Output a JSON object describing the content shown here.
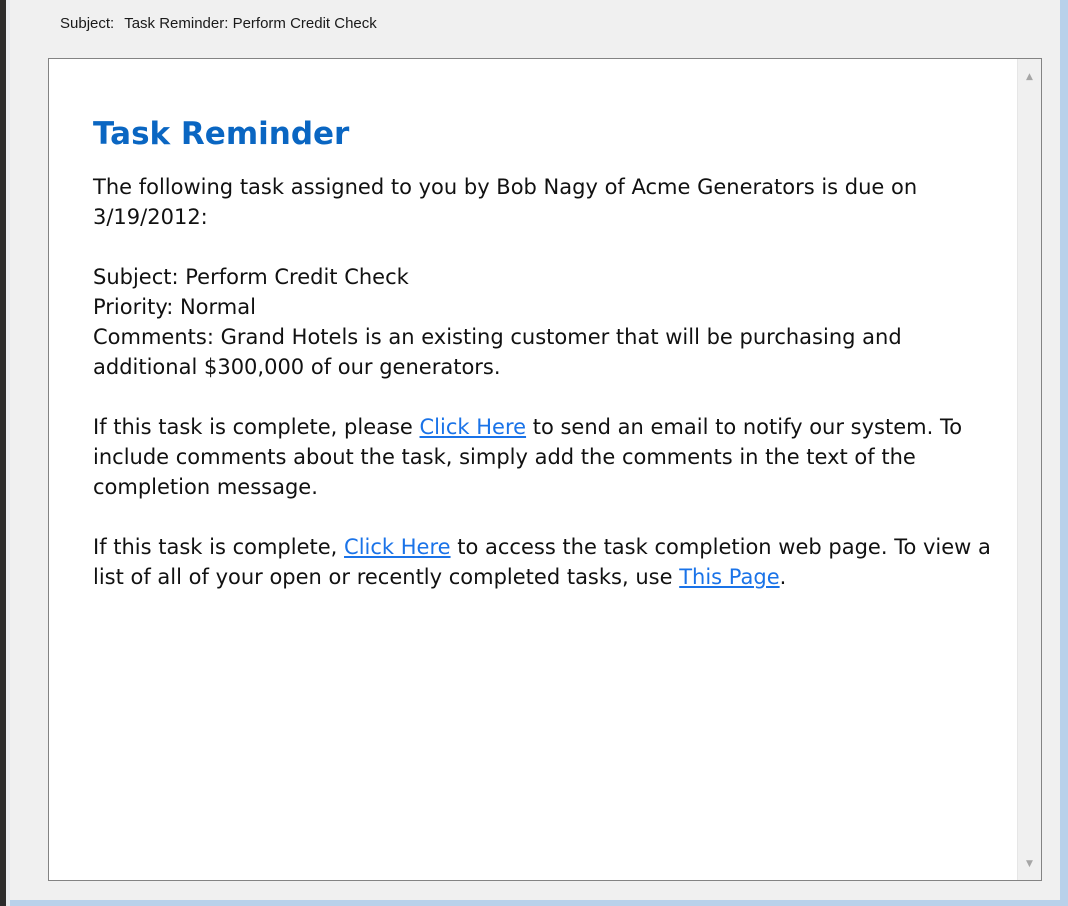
{
  "header": {
    "subject_label": "Subject:",
    "subject_value": "Task Reminder: Perform Credit Check"
  },
  "message": {
    "heading": "Task Reminder",
    "intro": "The following task assigned to you by Bob Nagy of Acme Generators is due on 3/19/2012:",
    "subject_line": "Subject: Perform Credit Check",
    "priority_line": "Priority: Normal",
    "comments_line": "Comments: Grand Hotels is an existing customer that will be purchasing and additional $300,000 of our generators.",
    "para1_before": "If this task is complete, please ",
    "para1_link": "Click Here",
    "para1_after": " to send an email to notify our system. To include comments about the task, simply add the comments in the text of the completion message.",
    "para2_before": "If this task is complete, ",
    "para2_link": "Click Here",
    "para2_middle": " to access the task completion web page. To view a list of all of your open or recently completed tasks, use ",
    "para2_link2": "This Page",
    "para2_after": "."
  },
  "scrollbar": {
    "up_icon": "chevron-up-icon",
    "down_icon": "chevron-down-icon"
  },
  "colors": {
    "heading": "#0a66c2",
    "link": "#1a73e8",
    "frame": "#b9d1ea",
    "window_background": "#f0f0f0"
  }
}
